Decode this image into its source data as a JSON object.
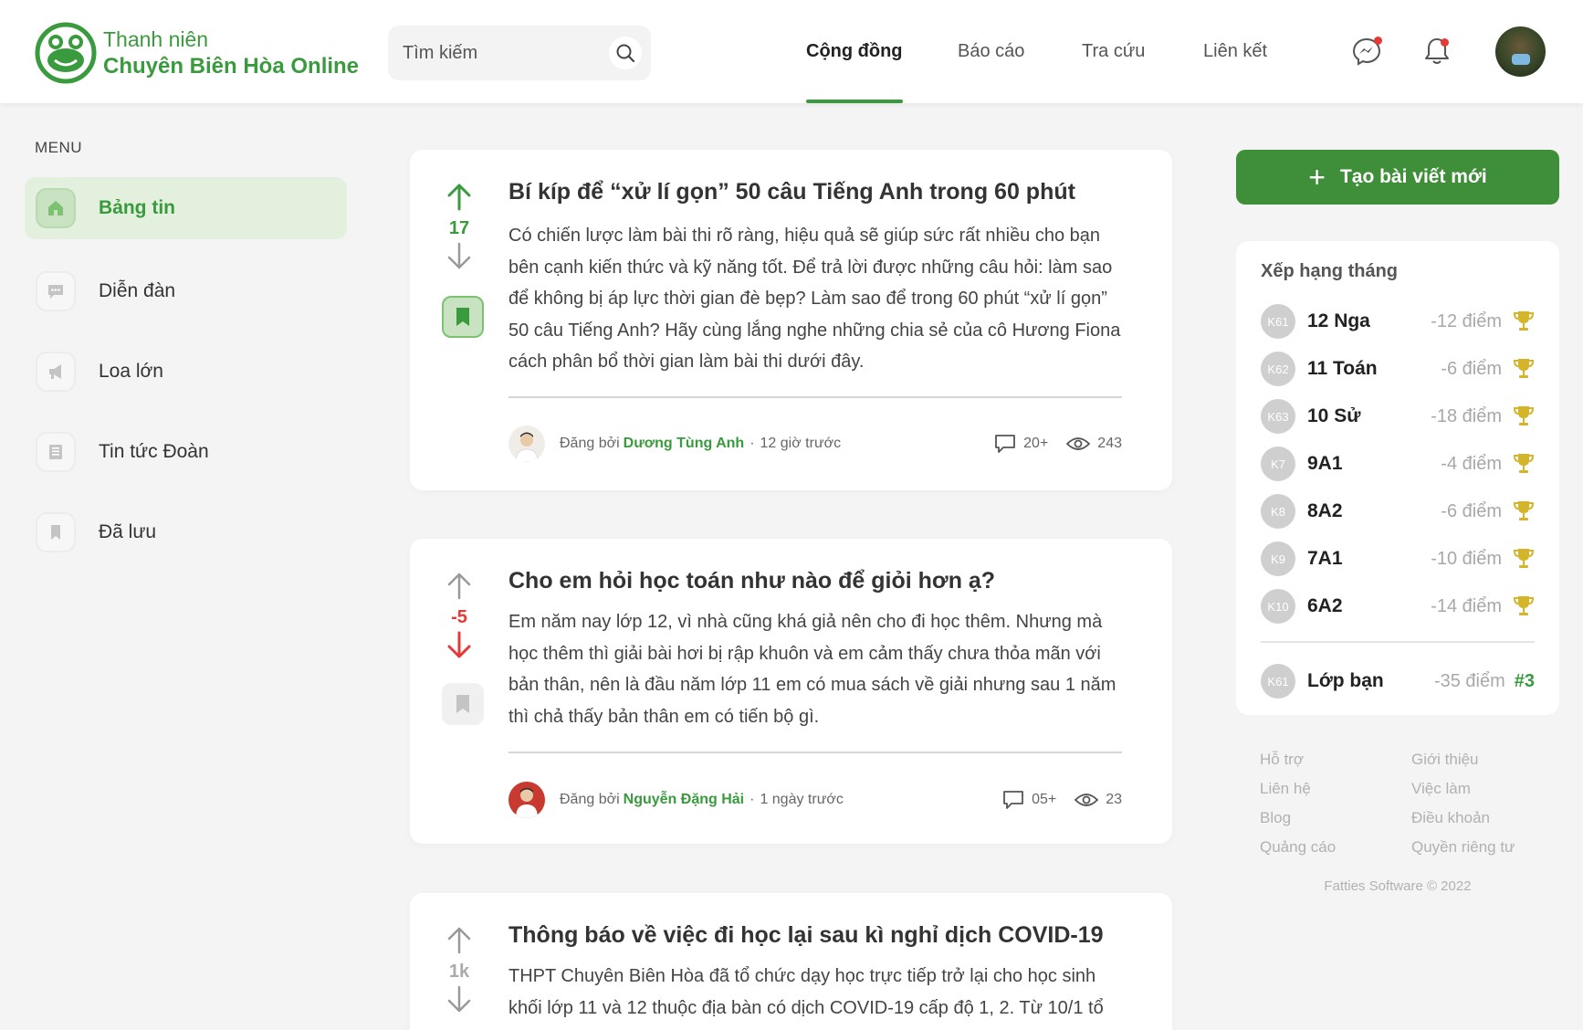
{
  "brand": {
    "line1": "Thanh niên",
    "line2": "Chuyên Biên Hòa Online",
    "logo_icon": "frog-logo-icon"
  },
  "search": {
    "placeholder": "Tìm kiếm",
    "icon": "search-icon"
  },
  "nav": [
    {
      "label": "Cộng đồng",
      "active": true
    },
    {
      "label": "Báo cáo",
      "active": false
    },
    {
      "label": "Tra cứu",
      "active": false
    },
    {
      "label": "Liên kết",
      "active": false
    }
  ],
  "header_icons": [
    "messenger-icon",
    "bell-icon",
    "avatar"
  ],
  "sidebar": {
    "title": "MENU",
    "items": [
      {
        "label": "Bảng tin",
        "icon": "home-icon",
        "active": true
      },
      {
        "label": "Diễn đàn",
        "icon": "chat-icon",
        "active": false
      },
      {
        "label": "Loa lớn",
        "icon": "megaphone-icon",
        "active": false
      },
      {
        "label": "Tin tức Đoàn",
        "icon": "news-icon",
        "active": false
      },
      {
        "label": "Đã lưu",
        "icon": "bookmark-icon",
        "active": false
      }
    ]
  },
  "posts": [
    {
      "votes": "17",
      "vote_state": "up",
      "saved": true,
      "title": "Bí kíp để “xử lí gọn” 50 câu Tiếng Anh trong 60 phút",
      "body": "Có chiến lược làm bài thi rõ ràng, hiệu quả sẽ giúp sức rất nhiều cho bạn bên cạnh kiến thức và kỹ năng tốt. Để trả lời được những câu hỏi: làm sao để không bị áp lực thời gian đè bẹp? Làm sao để trong 60 phút “xử lí gọn” 50 câu Tiếng Anh? Hãy cùng lắng nghe những chia sẻ của cô Hương Fiona cách phân bổ thời gian làm bài thi dưới đây.",
      "posted_by": "Đăng bởi",
      "author": "Dương Tùng Anh",
      "time": "12 giờ trước",
      "comments": "20+",
      "views": "243"
    },
    {
      "votes": "-5",
      "vote_state": "down",
      "saved": false,
      "title": "Cho em hỏi học toán như nào để giỏi hơn ạ?",
      "body": "Em năm nay lớp 12, vì nhà cũng khá giả nên cho đi học thêm. Nhưng mà học thêm thì giải bài hơi bị rập khuôn và em cảm thấy chưa thỏa mãn với bản thân, nên là đầu năm lớp 11 em có mua sách về giải nhưng sau 1 năm thì chả thấy bản thân em có tiến bộ gì.",
      "posted_by": "Đăng bởi",
      "author": "Nguyễn Đặng Hải",
      "time": "1 ngày trước",
      "comments": "05+",
      "views": "23"
    },
    {
      "votes": "1k",
      "vote_state": "none",
      "saved": false,
      "title": "Thông báo về việc đi học lại sau kì nghỉ dịch COVID-19",
      "body": "THPT Chuyên Biên Hòa đã tổ chức dạy học trực tiếp trở lại cho học sinh khối lớp 11 và 12 thuộc địa bàn có dịch COVID-19 cấp độ 1, 2. Từ 10/1 tổ"
    }
  ],
  "create_button": {
    "label": "Tạo bài viết mới",
    "icon": "plus-icon"
  },
  "ranking": {
    "title": "Xếp hạng tháng",
    "rows": [
      {
        "badge": "K61",
        "name": "12 Nga",
        "points": "-12 điểm"
      },
      {
        "badge": "K62",
        "name": "11 Toán",
        "points": "-6 điểm"
      },
      {
        "badge": "K63",
        "name": "10 Sử",
        "points": "-18 điểm"
      },
      {
        "badge": "K7",
        "name": "9A1",
        "points": "-4 điểm"
      },
      {
        "badge": "K8",
        "name": "8A2",
        "points": "-6 điểm"
      },
      {
        "badge": "K9",
        "name": "7A1",
        "points": "-10 điểm"
      },
      {
        "badge": "K10",
        "name": "6A2",
        "points": "-14 điểm"
      }
    ],
    "mine": {
      "badge": "K61",
      "name": "Lớp bạn",
      "points": "-35 điểm",
      "rank": "#3"
    }
  },
  "footer": {
    "links": [
      "Hỗ trợ",
      "Giới thiệu",
      "Liên hệ",
      "Việc làm",
      "Blog",
      "Điều khoản",
      "Quảng cáo",
      "Quyền riêng tư"
    ],
    "copyright": "Fatties Software © 2022"
  },
  "colors": {
    "accent": "#3a9a3e",
    "button": "#3f8f3a",
    "upvote": "#3a9a3e",
    "downvote": "#e53935",
    "trophy": "#d4b52a"
  }
}
